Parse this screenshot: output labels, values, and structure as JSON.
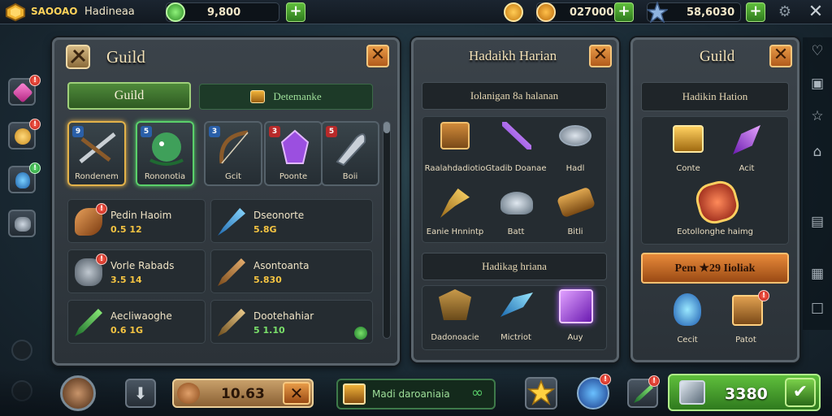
{
  "topbar": {
    "player_level": "SAOOAO",
    "player_name": "Hadineaa",
    "gems_value": "9,800",
    "gold_value": "027000",
    "crystal_value": "58,6030"
  },
  "guild_panel": {
    "title": "Guild",
    "tab_active": "Guild",
    "tab_other": "Detemanke",
    "featured": [
      {
        "label": "Rondenem",
        "badge": "9",
        "color": "#e3b24a"
      },
      {
        "label": "Rononotia",
        "badge": "5",
        "color": "#5ad06a"
      },
      {
        "label": "Gcit",
        "badge": "3",
        "color": "#4aa0d8"
      },
      {
        "label": "Poonte",
        "badge": "3",
        "color": "#d04a5a"
      },
      {
        "label": "Boii",
        "badge": "5",
        "color": "#d04a5a"
      }
    ],
    "items": [
      {
        "name": "Pedin Haoim",
        "value": "0.5 12"
      },
      {
        "name": "Dseonorte",
        "value": "5.8G"
      },
      {
        "name": "Vorle Rabads",
        "value": "3.5 14"
      },
      {
        "name": "Asontoanta",
        "value": "5.830"
      },
      {
        "name": "Aecliwaoghe",
        "value": "0.6 1G"
      },
      {
        "name": "Dootehahiar",
        "value": "5 1.10"
      }
    ]
  },
  "daily_panel": {
    "title": "Hadaikh Harian",
    "section1_header": "Iolanigan 8a halanan",
    "rewards": [
      {
        "label": "Raalahdadiotio"
      },
      {
        "label": "Gtadib Doanae"
      },
      {
        "label": "Hadl"
      },
      {
        "label": "Eanie Hnnintp"
      },
      {
        "label": "Batt"
      },
      {
        "label": "Bitli"
      }
    ],
    "section2_header": "Hadikag hriana",
    "rewards2": [
      {
        "label": "Dadonoacie"
      },
      {
        "label": "Mictriot"
      },
      {
        "label": "Auy"
      }
    ]
  },
  "guild2_panel": {
    "title": "Guild",
    "header": "Hadikin Hation",
    "items": [
      {
        "label": "Conte"
      },
      {
        "label": "Acit"
      }
    ],
    "big_item_label": "Eotollonghe haimg",
    "claim_label": "Pem ★29 Iioliak",
    "bottom_items": [
      {
        "label": "Cecit"
      },
      {
        "label": "Patot"
      }
    ]
  },
  "bottombar": {
    "counter_value": "10.63",
    "chest_label": "Madi daroaniaia",
    "total_value": "3380"
  }
}
